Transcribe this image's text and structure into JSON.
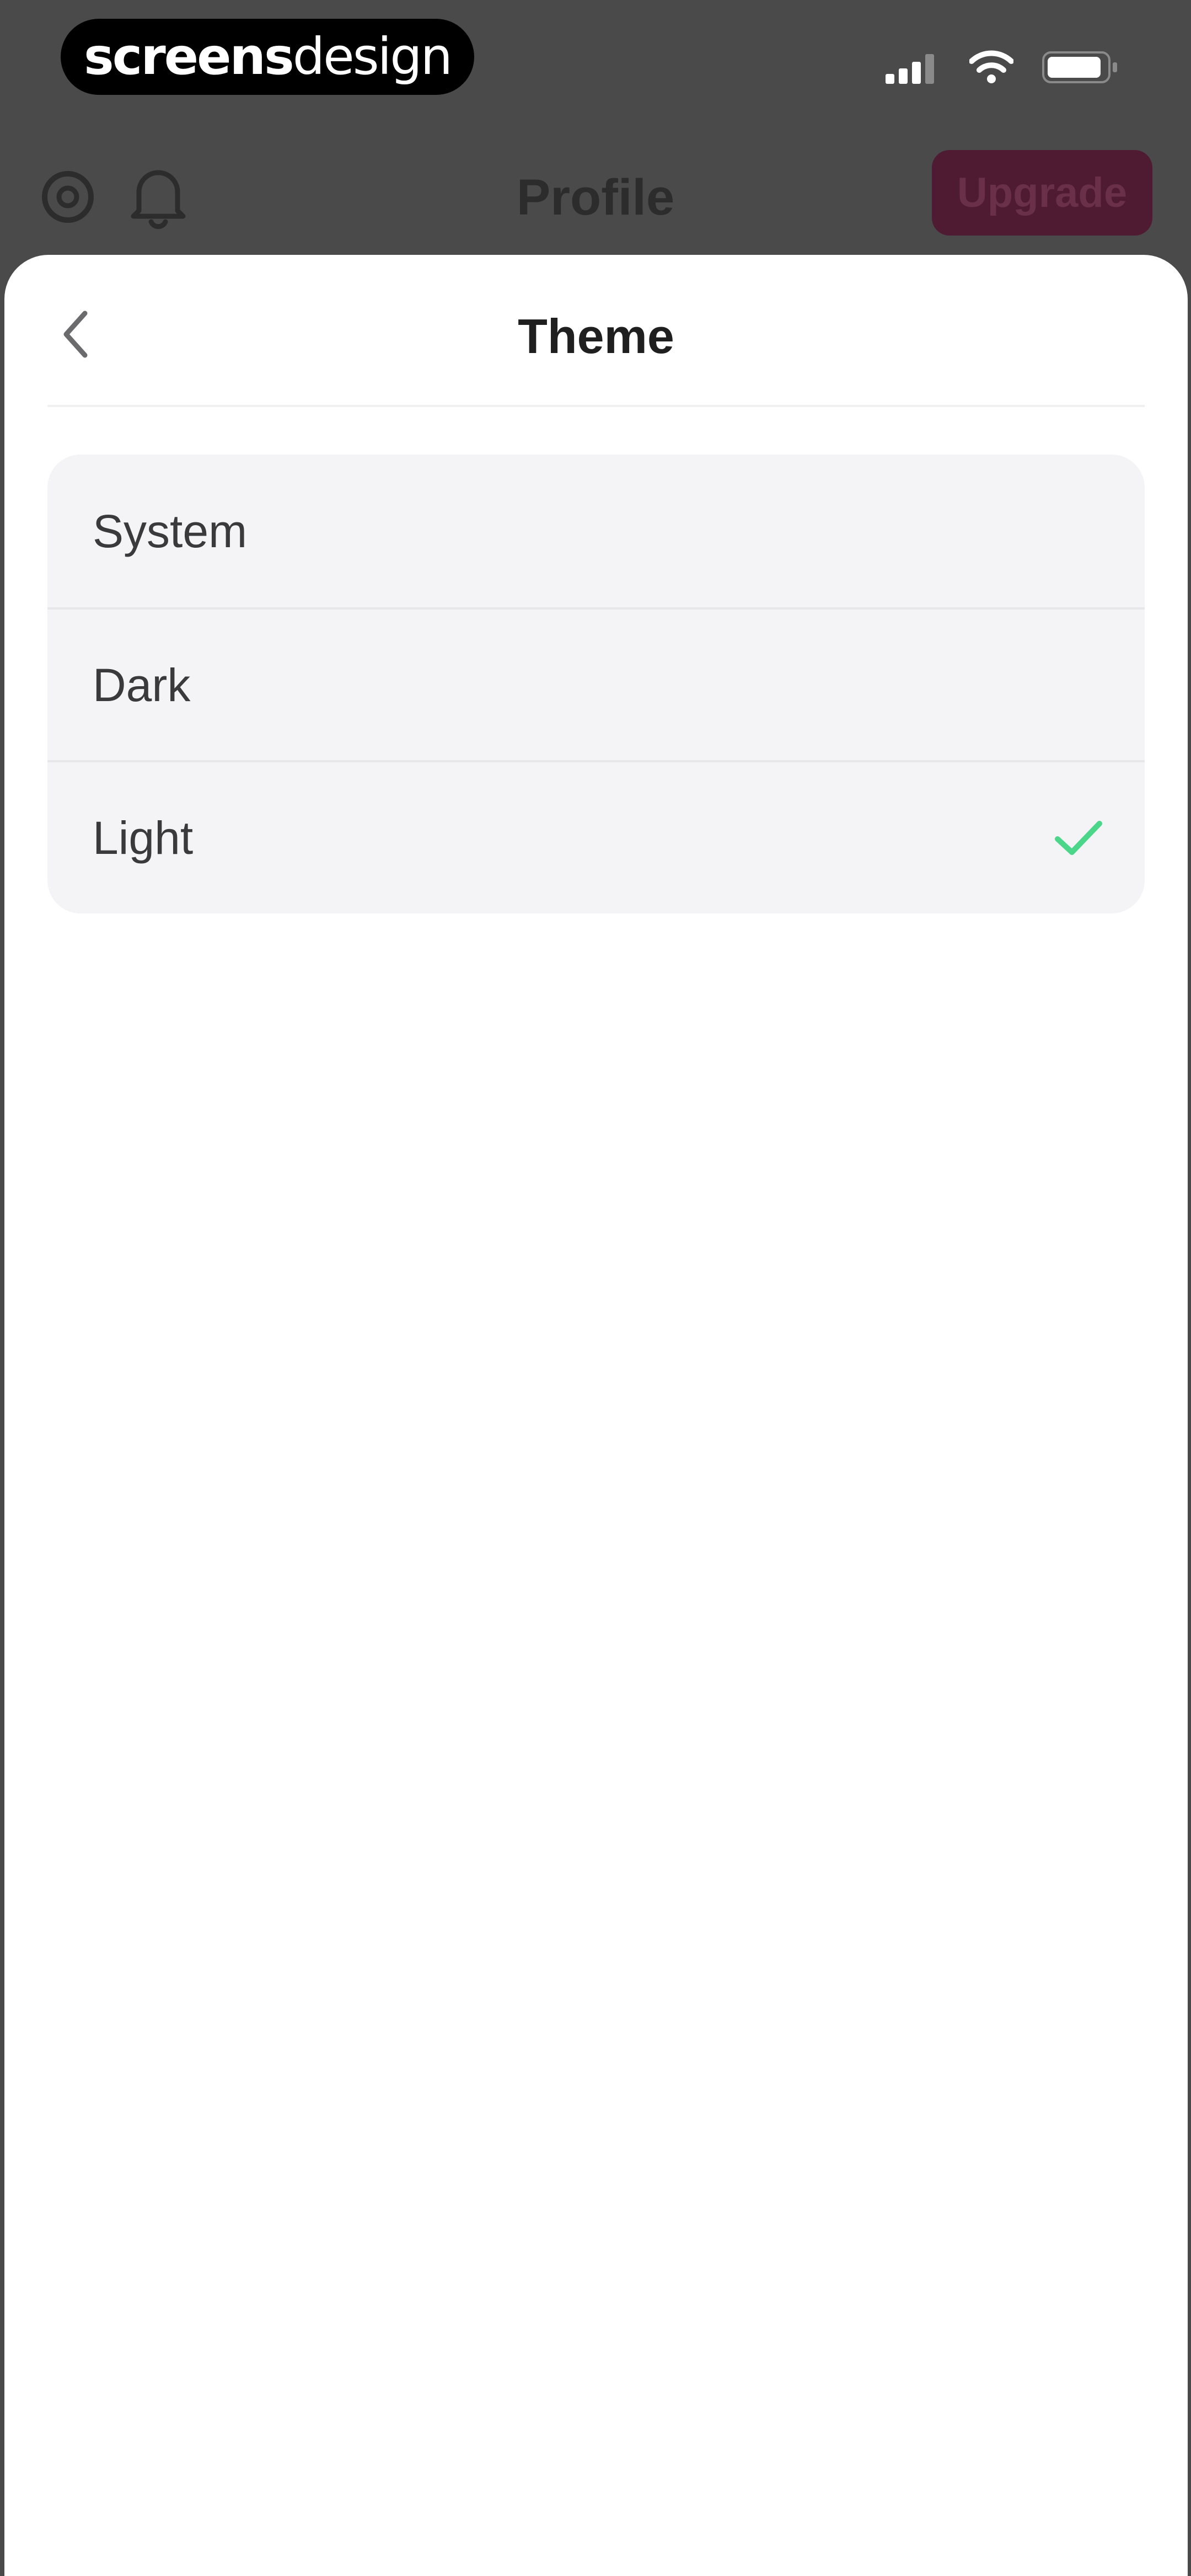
{
  "status_bar": {
    "brand_bold": "screens",
    "brand_light": "design",
    "icons": [
      "cellular-signal-icon",
      "wifi-icon",
      "battery-icon"
    ]
  },
  "background_header": {
    "title": "Profile",
    "upgrade_label": "Upgrade",
    "icons": [
      "settings-icon",
      "bell-icon"
    ]
  },
  "sheet": {
    "title": "Theme",
    "back_icon": "chevron-left-icon",
    "options": [
      {
        "label": "System",
        "selected": false
      },
      {
        "label": "Dark",
        "selected": false
      },
      {
        "label": "Light",
        "selected": true
      }
    ],
    "selected_check_color": "#4cd68a"
  },
  "colors": {
    "dim_overlay": "#4a4a4a",
    "sheet_background": "#ffffff",
    "options_background": "#f4f4f6",
    "upgrade_button": "#4e1b33"
  }
}
